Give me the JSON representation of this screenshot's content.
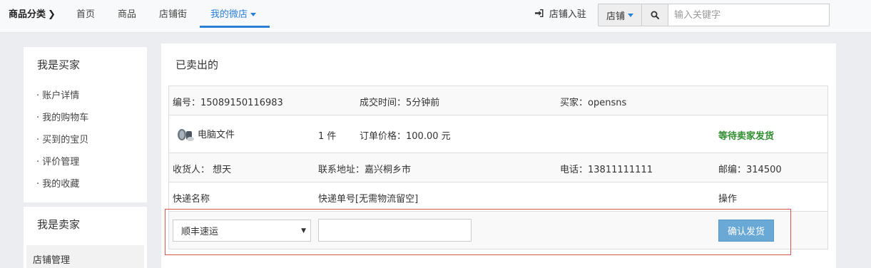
{
  "nav": {
    "category_label": "商品分类",
    "category_chevron": "❯",
    "links": [
      "首页",
      "商品",
      "店铺街"
    ],
    "active_link": "我的微店",
    "shop_join": "店铺入驻",
    "search_scope": "店铺",
    "search_placeholder": "输入关键字"
  },
  "sidebar": {
    "buyer_title": "我是买家",
    "buyer_items": [
      "· 账户详情",
      "· 我的购物车",
      "· 买到的宝贝",
      "· 评价管理",
      "· 我的收藏"
    ],
    "seller_title": "我是卖家",
    "seller_selected": "店铺管理"
  },
  "main": {
    "title": "已卖出的",
    "order": {
      "order_no": "编号：15089150116983",
      "deal_time": "成交时间：5分钟前",
      "buyer": "买家：opensns",
      "product_name": "电脑文件",
      "quantity": "1 件",
      "price": "订单价格：100.00 元",
      "status": "等待卖家发货",
      "receiver": "收货人： 想天",
      "address": "联系地址：嘉兴桐乡市",
      "phone": "电话：13811111111",
      "zip": "邮编：314500",
      "courier_header": "快递名称",
      "tracking_header": "快递单号[无需物流留空]",
      "action_header": "操作",
      "courier_selected": "顺丰速运",
      "tracking_value": "",
      "confirm_button": "确认发货"
    }
  },
  "colors": {
    "accent": "#2a7fd6",
    "status_green": "#2f8d2f",
    "button_blue": "#6aa8d6",
    "highlight_red": "#d9534f"
  }
}
